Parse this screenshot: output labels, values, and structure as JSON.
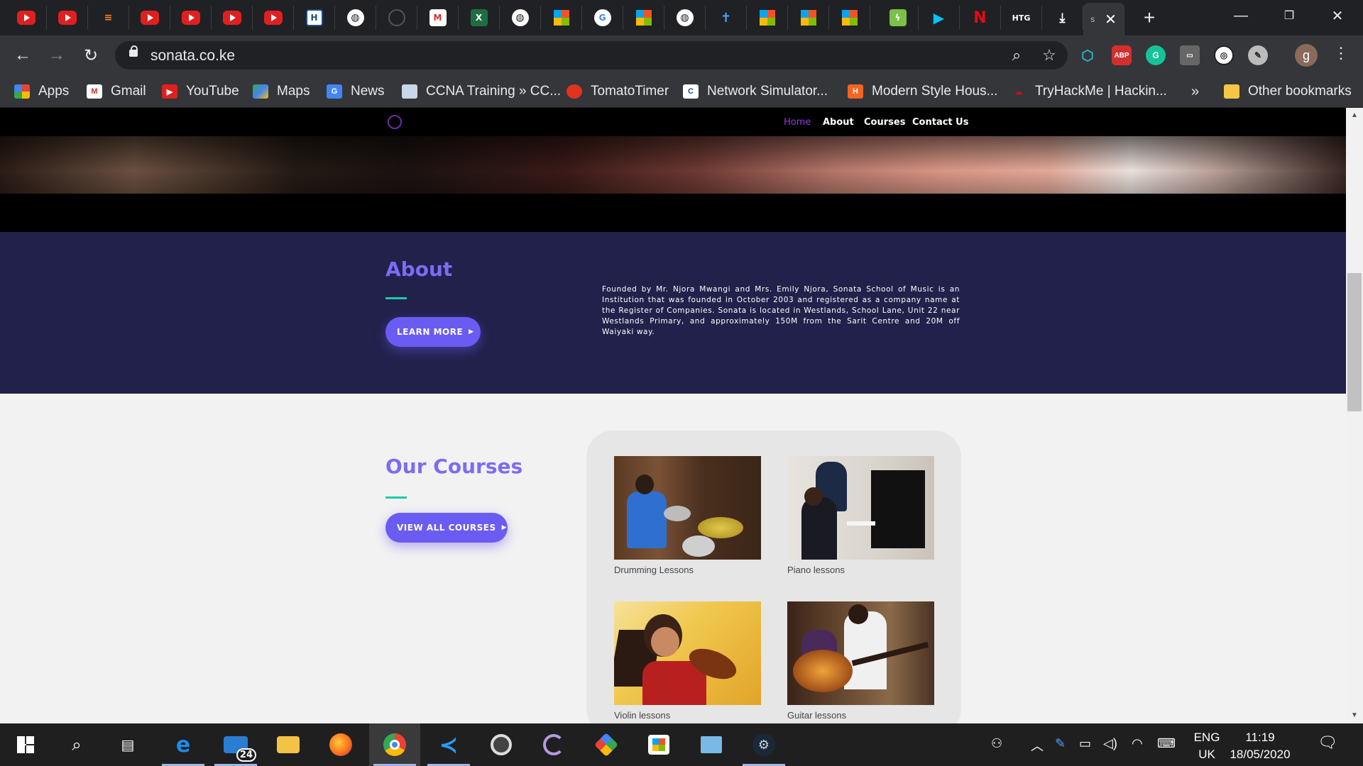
{
  "browser": {
    "url": "sonata.co.ke",
    "tabs": [
      {
        "icon": "youtube-icon"
      },
      {
        "icon": "youtube-icon"
      },
      {
        "icon": "stackoverflow-icon"
      },
      {
        "icon": "youtube-icon"
      },
      {
        "icon": "youtube-icon"
      },
      {
        "icon": "youtube-icon"
      },
      {
        "icon": "youtube-icon"
      },
      {
        "icon": "h-icon"
      },
      {
        "icon": "globe-icon"
      },
      {
        "icon": "github-icon"
      },
      {
        "icon": "gmail-icon"
      },
      {
        "icon": "excel-icon"
      },
      {
        "icon": "globe-icon"
      },
      {
        "icon": "microsoft-icon"
      },
      {
        "icon": "google-icon"
      },
      {
        "icon": "microsoft-icon"
      },
      {
        "icon": "globe-icon"
      },
      {
        "icon": "cross-icon"
      },
      {
        "icon": "microsoft-icon"
      },
      {
        "icon": "microsoft-icon"
      },
      {
        "icon": "microsoft-icon"
      },
      {
        "icon": "bolt-icon"
      },
      {
        "icon": "google-play-icon"
      },
      {
        "icon": "netflix-icon"
      },
      {
        "icon": "htg-icon",
        "text": "HTG"
      },
      {
        "icon": "download-icon"
      }
    ],
    "active_tab_glyph": "s",
    "bookmarks": [
      {
        "label": "Apps",
        "icon": "apps-grid-icon"
      },
      {
        "label": "Gmail",
        "icon": "gmail-icon"
      },
      {
        "label": "YouTube",
        "icon": "youtube-icon"
      },
      {
        "label": "Maps",
        "icon": "maps-icon"
      },
      {
        "label": "News",
        "icon": "news-icon"
      },
      {
        "label": "CCNA Training » CC...",
        "icon": "ccna-icon"
      },
      {
        "label": "TomatoTimer",
        "icon": "tomato-icon"
      },
      {
        "label": "Network Simulator...",
        "icon": "network-simulator-icon"
      },
      {
        "label": "Modern Style Hous...",
        "icon": "houzz-icon"
      },
      {
        "label": "TryHackMe | Hackin...",
        "icon": "tryhackme-icon"
      }
    ],
    "bookmarks_more": "»",
    "other_bookmarks": "Other bookmarks",
    "extensions": {
      "abp": "ABP",
      "profile_initial": "g"
    }
  },
  "site": {
    "nav": {
      "items": [
        {
          "label": "Home",
          "active": true
        },
        {
          "label": "About",
          "active": false
        },
        {
          "label": "Courses",
          "active": false
        },
        {
          "label": "Contact Us",
          "active": false
        }
      ]
    },
    "about": {
      "title": "About",
      "button": "LEARN MORE",
      "text": "Founded by Mr. Njora Mwangi and Mrs. Emily Njora, Sonata School of Music is an Institution that was founded in October 2003 and registered as a company name at the Register of Companies. Sonata is located in Westlands, School Lane, Unit 22 near Westlands Primary, and approximately 150M from the Sarit Centre and 20M off Waiyaki way."
    },
    "courses": {
      "title": "Our Courses",
      "button": "VIEW ALL COURSES",
      "items": [
        {
          "caption": "Drumming Lessons"
        },
        {
          "caption": "Piano lessons"
        },
        {
          "caption": "Violin lessons"
        },
        {
          "caption": "Guitar lessons"
        }
      ]
    },
    "colors": {
      "accent": "#6a5cf2",
      "about_bg": "#21214b",
      "rule": "#20c9a6",
      "nav_active": "#8e3bd8"
    }
  },
  "taskbar": {
    "mail_badge": "24",
    "language": {
      "line1": "ENG",
      "line2": "UK"
    },
    "clock": {
      "time": "11:19",
      "date": "18/05/2020"
    }
  }
}
